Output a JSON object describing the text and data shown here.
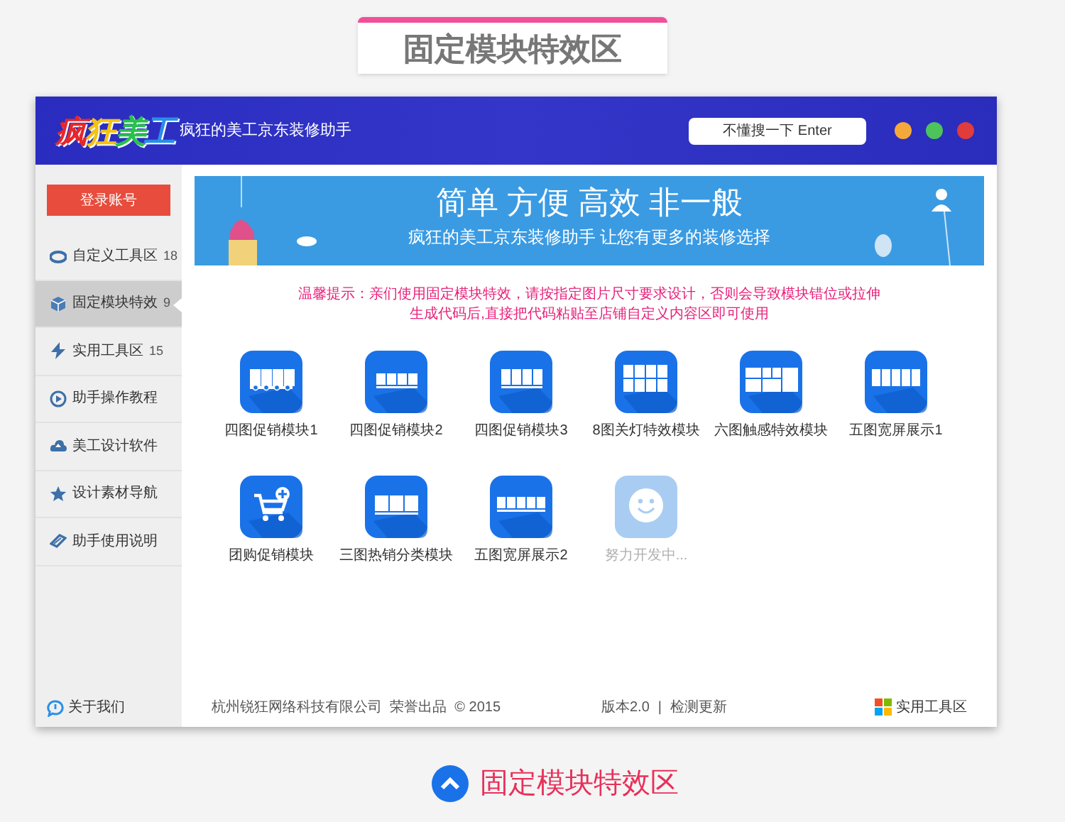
{
  "heading": "固定模块特效区",
  "window": {
    "logo": "疯狂美工",
    "title": "疯狂的美工京东装修助手",
    "search": {
      "placeholder": "不懂搜一下 Enter"
    }
  },
  "sidebar": {
    "login_button": "登录账号",
    "items": [
      {
        "label": "自定义工具区",
        "count": "18",
        "selected": false
      },
      {
        "label": "固定模块特效",
        "count": "9",
        "selected": true
      },
      {
        "label": "实用工具区",
        "count": "15",
        "selected": false
      },
      {
        "label": "助手操作教程",
        "selected": false
      },
      {
        "label": "美工设计软件",
        "selected": false
      },
      {
        "label": "设计素材导航",
        "selected": false
      },
      {
        "label": "助手使用说明",
        "selected": false
      }
    ],
    "about": "关于我们"
  },
  "banner": {
    "headline": "简单 方便 高效 非一般",
    "subtitle": "疯狂的美工京东装修助手 让您有更多的装修选择"
  },
  "notice": [
    "温馨提示：亲们使用固定模块特效，请按指定图片尺寸要求设计，否则会导致模块错位或拉伸",
    "生成代码后,直接把代码粘贴至店铺自定义内容区即可使用"
  ],
  "modules": [
    {
      "label": "四图促销模块1",
      "kind": "row4dots",
      "disabled": false
    },
    {
      "label": "四图促销模块2",
      "kind": "row4",
      "disabled": false
    },
    {
      "label": "四图促销模块3",
      "kind": "row4tall",
      "disabled": false
    },
    {
      "label": "8图关灯特效模块",
      "kind": "grid8",
      "disabled": false
    },
    {
      "label": "六图触感特效模块",
      "kind": "grid6",
      "disabled": false
    },
    {
      "label": "五图宽屏展示1",
      "kind": "row5",
      "disabled": false
    },
    {
      "label": "团购促销模块",
      "kind": "cart",
      "disabled": false
    },
    {
      "label": "三图热销分类模块",
      "kind": "row3",
      "disabled": false
    },
    {
      "label": "五图宽屏展示2",
      "kind": "row5thin",
      "disabled": false
    },
    {
      "label": "努力开发中...",
      "kind": "smiley",
      "disabled": true
    }
  ],
  "footer": {
    "company": "杭州锐狂网络科技有限公司  荣誉出品  © 2015",
    "version": "版本2.0",
    "separator": "|",
    "update_link": "检测更新",
    "tools": "实用工具区"
  },
  "caption": "固定模块特效区"
}
